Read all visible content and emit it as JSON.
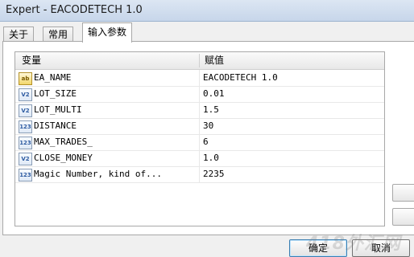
{
  "window": {
    "title": "Expert - EACODETECH 1.0"
  },
  "tabs": [
    {
      "label": "关于"
    },
    {
      "label": "常用"
    },
    {
      "label": "输入参数"
    }
  ],
  "grid": {
    "headers": {
      "variable": "变量",
      "value": "赋值"
    },
    "rows": [
      {
        "type_icon": "ab",
        "name": "EA_NAME",
        "value": "EACODETECH 1.0"
      },
      {
        "type_icon": "V2",
        "name": "LOT_SIZE",
        "value": "0.01"
      },
      {
        "type_icon": "V2",
        "name": "LOT_MULTI",
        "value": "1.5"
      },
      {
        "type_icon": "123",
        "name": "DISTANCE",
        "value": "30"
      },
      {
        "type_icon": "123",
        "name": "MAX_TRADES_",
        "value": "6"
      },
      {
        "type_icon": "V2",
        "name": "CLOSE_MONEY",
        "value": "1.0"
      },
      {
        "type_icon": "123",
        "name": "Magic Number, kind of...",
        "value": "2235"
      }
    ]
  },
  "buttons": {
    "ok": "确定",
    "cancel": "取消"
  },
  "watermark": "418外汇网"
}
